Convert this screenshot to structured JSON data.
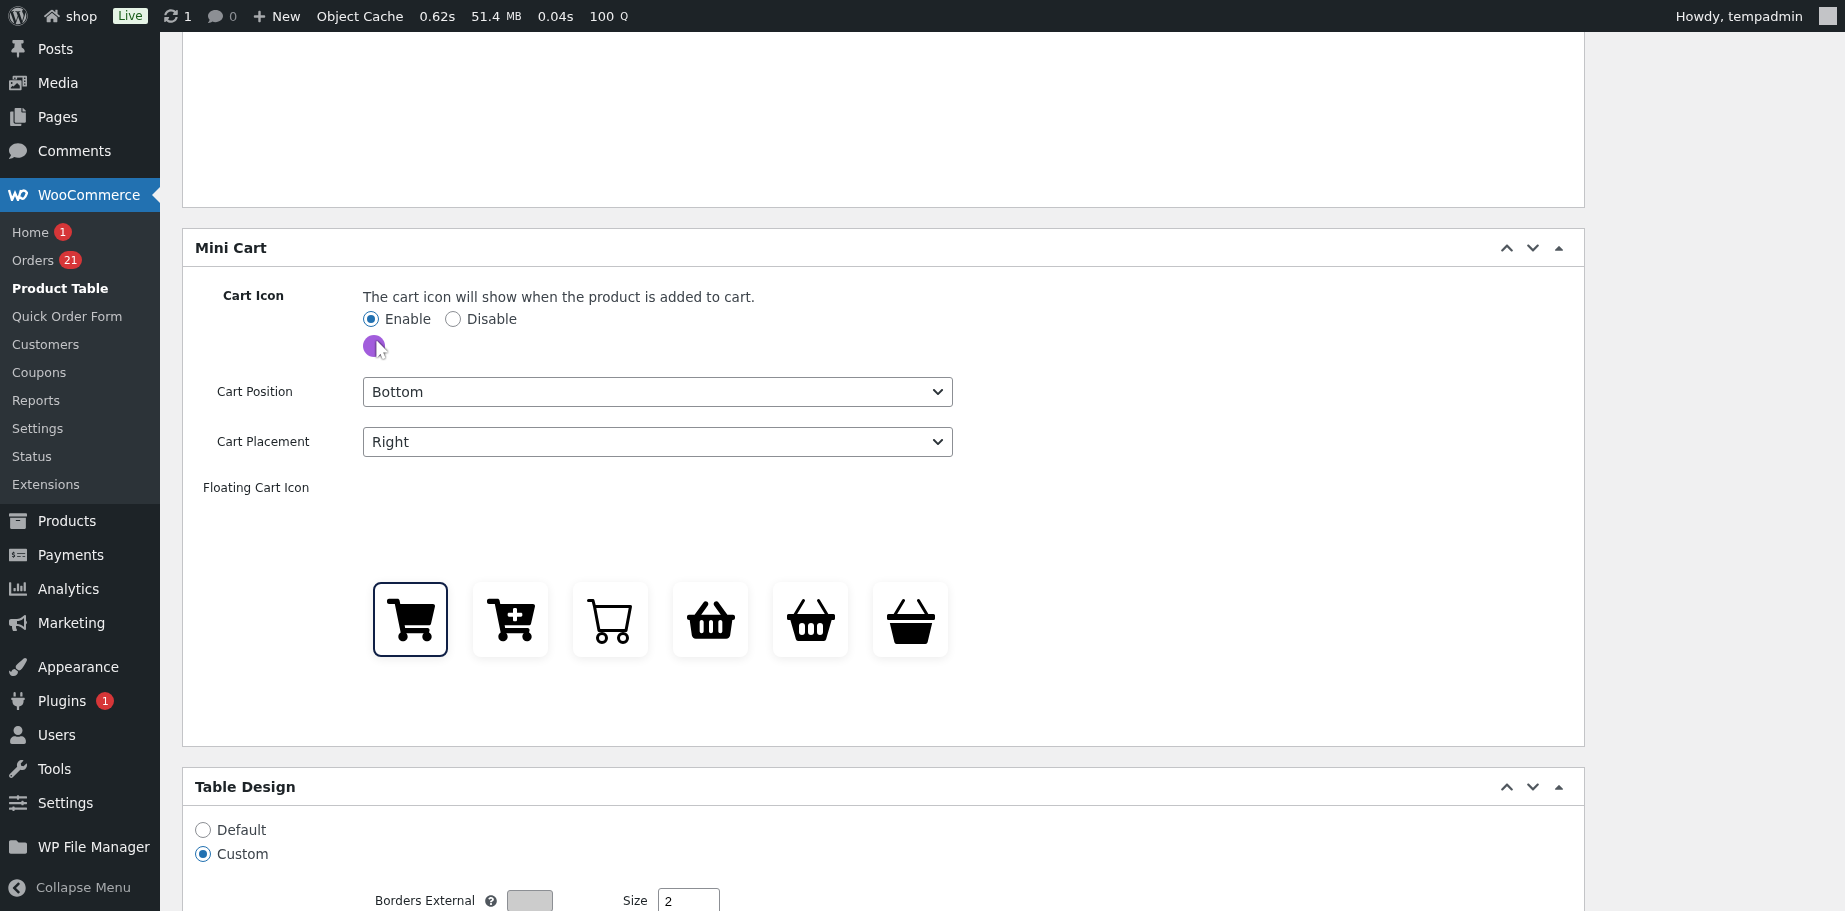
{
  "admin_bar": {
    "site": "shop",
    "badge": "Live",
    "updates": "1",
    "comments": "0",
    "new": "New",
    "cache": "Object Cache",
    "stats": [
      {
        "value": "0.62s"
      },
      {
        "value": "51.4",
        "unit": "MB"
      },
      {
        "value": "0.04s"
      },
      {
        "value": "100",
        "unit": "Q"
      }
    ],
    "greeting": "Howdy, tempadmin"
  },
  "sidebar": {
    "groups": [
      [
        {
          "label": "Posts",
          "selected": false
        },
        {
          "label": "Media",
          "selected": false
        },
        {
          "label": "Pages",
          "selected": false
        },
        {
          "label": "Comments",
          "selected": false
        }
      ],
      [
        {
          "label": "WooCommerce",
          "selected": true,
          "children": [
            {
              "label": "Home",
              "badge": "1",
              "selected": false
            },
            {
              "label": "Orders",
              "badge": "21",
              "selected": false
            },
            {
              "label": "Product Table",
              "selected": true
            },
            {
              "label": "Quick Order Form",
              "selected": false
            },
            {
              "label": "Customers",
              "selected": false
            },
            {
              "label": "Coupons",
              "selected": false
            },
            {
              "label": "Reports",
              "selected": false
            },
            {
              "label": "Settings",
              "selected": false
            },
            {
              "label": "Status",
              "selected": false
            },
            {
              "label": "Extensions",
              "selected": false
            }
          ]
        },
        {
          "label": "Products",
          "selected": false
        },
        {
          "label": "Payments",
          "selected": false
        },
        {
          "label": "Analytics",
          "selected": false
        },
        {
          "label": "Marketing",
          "selected": false
        }
      ],
      [
        {
          "label": "Appearance",
          "selected": false
        },
        {
          "label": "Plugins",
          "badge": "1",
          "selected": false
        },
        {
          "label": "Users",
          "selected": false
        },
        {
          "label": "Tools",
          "selected": false
        },
        {
          "label": "Settings",
          "selected": false
        }
      ],
      [
        {
          "label": "WP File Manager",
          "selected": false
        }
      ]
    ],
    "collapse": "Collapse Menu"
  },
  "mini_cart": {
    "title": "Mini Cart",
    "cart_icon": {
      "label": "Cart Icon",
      "description": "The cart icon will show when the product is added to cart.",
      "options": [
        {
          "label": "Enable",
          "selected": true
        },
        {
          "label": "Disable",
          "selected": false
        }
      ]
    },
    "selects": [
      {
        "label": "Cart Position",
        "value": "Bottom"
      },
      {
        "label": "Cart Placement",
        "value": "Right"
      }
    ],
    "floating_label": "Floating Cart Icon",
    "icons": [
      {
        "kind": "cart",
        "selected": true
      },
      {
        "kind": "grid-cart",
        "selected": false
      },
      {
        "kind": "thin-cart",
        "selected": false
      },
      {
        "kind": "basket",
        "selected": false
      },
      {
        "kind": "handle-basket",
        "selected": false
      },
      {
        "kind": "box-basket",
        "selected": false
      }
    ]
  },
  "table_design": {
    "title": "Table Design",
    "options": [
      {
        "label": "Default",
        "selected": false
      },
      {
        "label": "Custom",
        "selected": true
      }
    ],
    "borders_label": "Borders External",
    "size_label": "Size",
    "size_value": "2"
  }
}
